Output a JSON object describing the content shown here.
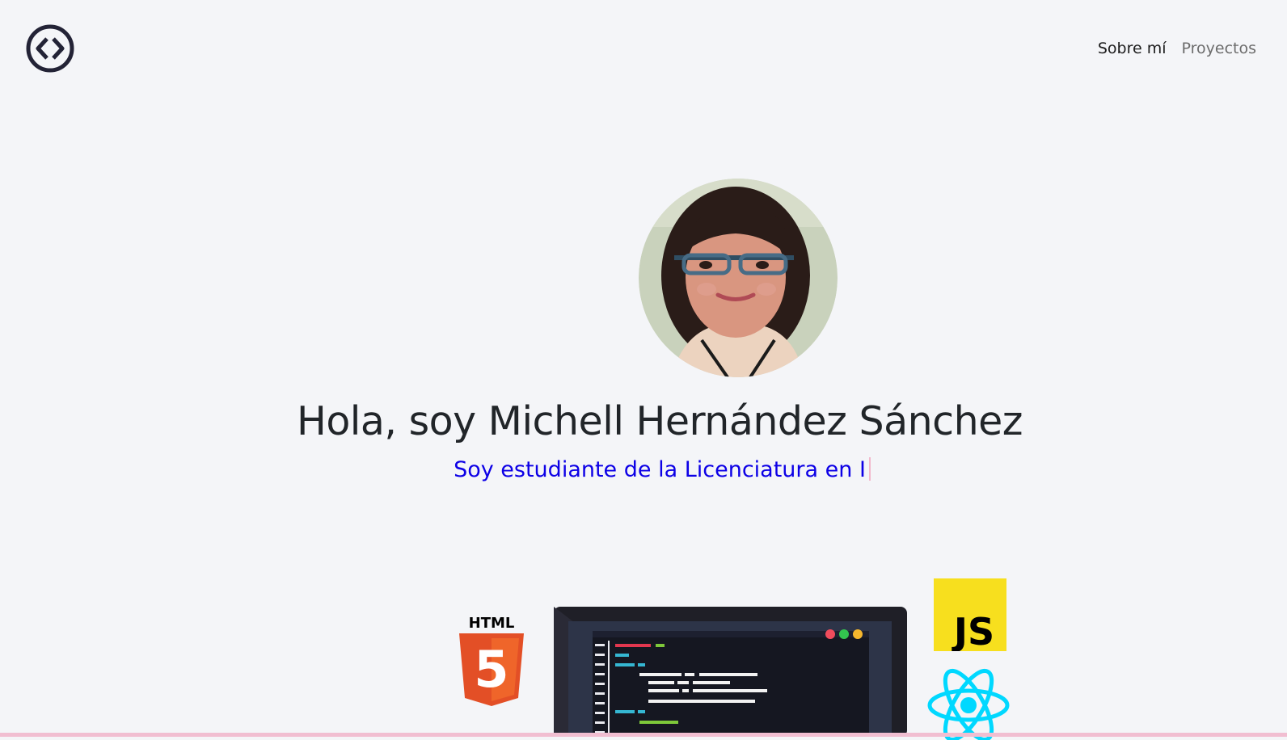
{
  "nav": {
    "items": [
      {
        "label": "Sobre mí",
        "active": true
      },
      {
        "label": "Proyectos",
        "active": false
      }
    ]
  },
  "hero": {
    "title": "Hola, soy Michell Hernández Sánchez",
    "subtitle": "Soy estudiante de la Licenciatura en I",
    "avatar_icon": "profile-photo"
  },
  "tech_icons": {
    "html_label": "HTML",
    "html_number": "5",
    "js_label": "JS",
    "react": "react-icon",
    "laptop": "code-editor-laptop-illustration"
  },
  "colors": {
    "background": "#f4f5f8",
    "subtitle": "#0d00e6",
    "html": "#e34f26",
    "js": "#f7df1e",
    "react": "#00d8ff"
  }
}
